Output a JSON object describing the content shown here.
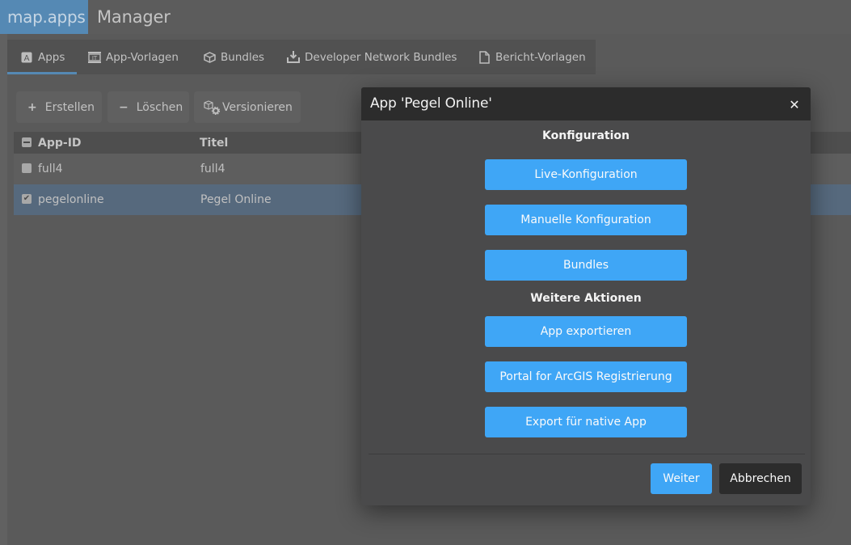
{
  "header": {
    "brand": "map.apps",
    "app_name": "Manager"
  },
  "tabs": [
    {
      "label": "Apps",
      "icon": "apps-icon",
      "active": true
    },
    {
      "label": "App-Vorlagen",
      "icon": "template-icon",
      "active": false
    },
    {
      "label": "Bundles",
      "icon": "bundle-icon",
      "active": false
    },
    {
      "label": "Developer Network Bundles",
      "icon": "download-icon",
      "active": false
    },
    {
      "label": "Bericht-Vorlagen",
      "icon": "document-icon",
      "active": false
    }
  ],
  "toolbar": {
    "create_label": "Erstellen",
    "create_symbol": "+",
    "delete_label": "Löschen",
    "delete_symbol": "−",
    "version_label": "Versionieren"
  },
  "grid": {
    "columns": [
      "App-ID",
      "Titel"
    ],
    "rows": [
      {
        "id": "full4",
        "title": "full4",
        "checked": false,
        "check_glyph": ""
      },
      {
        "id": "pegelonline",
        "title": "Pegel Online",
        "checked": true,
        "check_glyph": "✔"
      }
    ]
  },
  "modal": {
    "title": "App 'Pegel Online'",
    "close_glyph": "✕",
    "sections": [
      {
        "title": "Konfiguration",
        "buttons": [
          "Live-Konfiguration",
          "Manuelle Konfiguration",
          "Bundles"
        ]
      },
      {
        "title": "Weitere Aktionen",
        "buttons": [
          "App exportieren",
          "Portal for ArcGIS Registrierung",
          "Export für native App"
        ]
      }
    ],
    "next_label": "Weiter",
    "cancel_label": "Abbrechen"
  },
  "colors": {
    "accent": "#3fa6f6",
    "brand": "#5589b4",
    "selected_row": "#56697d",
    "modal_header": "#2c2c2c"
  }
}
